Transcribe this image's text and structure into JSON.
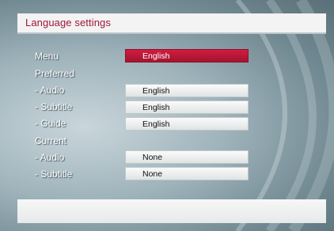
{
  "screen_title": "Language settings",
  "colors": {
    "accent": "#b8183a",
    "title_text": "#a0163a",
    "background": "#9fb3bb"
  },
  "rows": [
    {
      "label": "Menu",
      "value": "English",
      "selected": true
    },
    {
      "label": "Preferred",
      "value": null
    },
    {
      "label": "- Audio",
      "value": "English"
    },
    {
      "label": "- Subtitle",
      "value": "English"
    },
    {
      "label": "- Guide",
      "value": "English"
    },
    {
      "label": "Current",
      "value": null
    },
    {
      "label": "- Audio",
      "value": "None"
    },
    {
      "label": "- Subtitle",
      "value": "None"
    }
  ]
}
